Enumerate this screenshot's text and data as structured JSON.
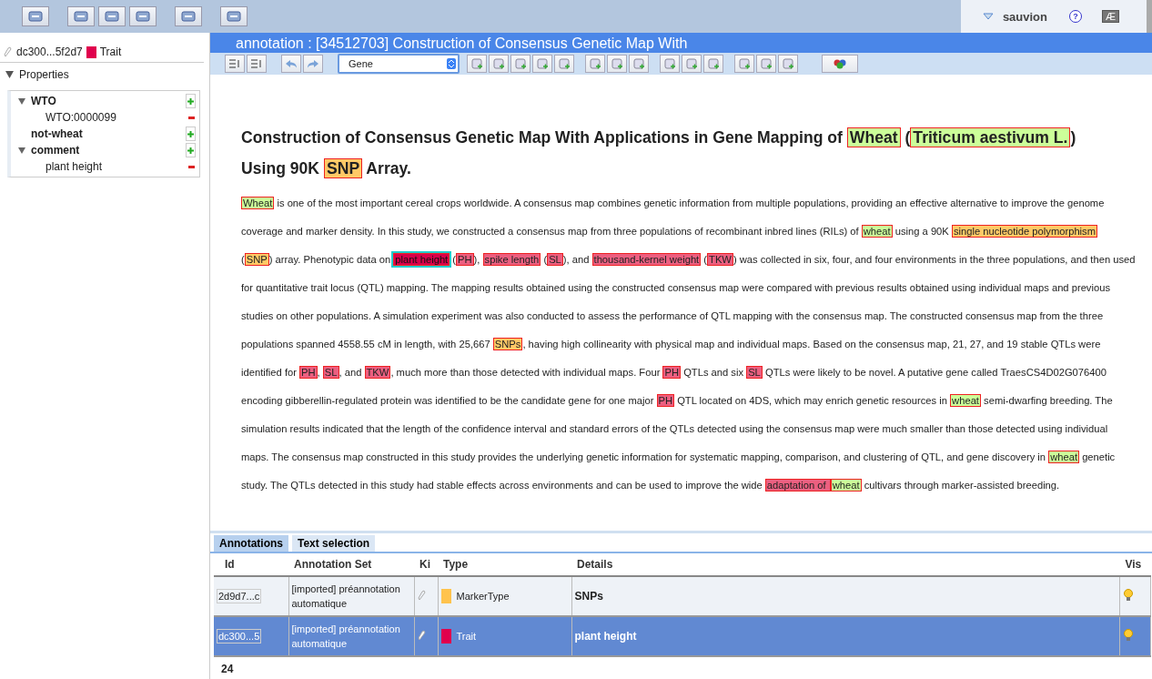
{
  "user": {
    "name": "sauvion",
    "help_label": "?",
    "keyboard_button": "Æ"
  },
  "left_panel": {
    "annotation_id": "dc300...5f2d7",
    "color": "#e0004d",
    "type_label": "Trait",
    "properties_label": "Properties",
    "properties_expanded": true,
    "properties": [
      {
        "label": "WTO",
        "expanded": true,
        "children": [
          {
            "label": "WTO:0000099"
          }
        ]
      },
      {
        "label": "not-wheat"
      },
      {
        "label": "comment",
        "expanded": true,
        "children": [
          {
            "label": "plant height"
          }
        ]
      }
    ]
  },
  "document": {
    "header_title": "annotation : [34512703] Construction of Consensus Genetic Map With",
    "type_select": "Gene",
    "title_lines": [
      [
        {
          "kind": "plain",
          "text": "Construction of Consensus Genetic Map With Applications in Gene Mapping of "
        },
        {
          "kind": "annotation",
          "text": "Wheat",
          "color": "#ccff99",
          "selected": false
        },
        {
          "kind": "plain",
          "text": " ("
        },
        {
          "kind": "annotation",
          "text": "Triticum aestivum L.",
          "color": "#ccff99",
          "selected": false
        },
        {
          "kind": "plain",
          "text": ")"
        }
      ],
      [
        {
          "kind": "plain",
          "text": "Using 90K "
        },
        {
          "kind": "annotation",
          "text": "SNP",
          "color": "#ffc966",
          "selected": false
        },
        {
          "kind": "plain",
          "text": " Array."
        }
      ]
    ],
    "abstract_lines": [
      [
        {
          "kind": "annotation",
          "text": "Wheat",
          "color": "#ccff99",
          "selected": false
        },
        {
          "kind": "plain",
          "text": " is one of the most important cereal crops worldwide. A consensus map combines genetic information from multiple populations, providing an effective alternative to improve the genome"
        }
      ],
      [
        {
          "kind": "plain",
          "text": "coverage and marker density. In this study, we constructed a consensus map from three populations of recombinant inbred lines (RILs) of "
        },
        {
          "kind": "annotation",
          "text": "wheat",
          "color": "#ccff99",
          "selected": false
        },
        {
          "kind": "plain",
          "text": " using a 90K "
        },
        {
          "kind": "annotation",
          "text": "single nucleotide polymorphism",
          "color": "#ffc966",
          "selected": false
        }
      ],
      [
        {
          "kind": "plain",
          "text": "("
        },
        {
          "kind": "annotation",
          "text": "SNP",
          "color": "#ffc966",
          "selected": false
        },
        {
          "kind": "plain",
          "text": ") array. Phenotypic data on "
        },
        {
          "kind": "annotation",
          "text": "plant height",
          "color": "#d8004a",
          "selected": true
        },
        {
          "kind": "plain",
          "text": " ("
        },
        {
          "kind": "annotation",
          "text": "PH",
          "color": "#ec5f80",
          "selected": false
        },
        {
          "kind": "plain",
          "text": "), "
        },
        {
          "kind": "annotation",
          "text": "spike length",
          "color": "#ec5f80",
          "selected": false
        },
        {
          "kind": "plain",
          "text": " ("
        },
        {
          "kind": "annotation",
          "text": "SL",
          "color": "#ec5f80",
          "selected": false
        },
        {
          "kind": "plain",
          "text": "), and "
        },
        {
          "kind": "annotation",
          "text": "thousand-kernel weight",
          "color": "#ec5f80",
          "selected": false
        },
        {
          "kind": "plain",
          "text": " ("
        },
        {
          "kind": "annotation",
          "text": "TKW",
          "color": "#ec5f80",
          "selected": false
        },
        {
          "kind": "plain",
          "text": ") was collected in six, four, and four environments in the three populations, and then used"
        }
      ],
      [
        {
          "kind": "plain",
          "text": "for quantitative trait locus (QTL) mapping. The mapping results obtained using the constructed consensus map were compared with previous results obtained using individual maps and previous"
        }
      ],
      [
        {
          "kind": "plain",
          "text": "studies on other populations. A simulation experiment was also conducted to assess the performance of QTL mapping with the consensus map. The constructed consensus map from the three"
        }
      ],
      [
        {
          "kind": "plain",
          "text": "populations spanned 4558.55 cM in length, with 25,667 "
        },
        {
          "kind": "annotation",
          "text": "SNPs",
          "color": "#ffc966",
          "selected": false
        },
        {
          "kind": "plain",
          "text": ", having high collinearity with physical map and individual maps. Based on the consensus map, 21, 27, and 19 stable QTLs were"
        }
      ],
      [
        {
          "kind": "plain",
          "text": "identified for "
        },
        {
          "kind": "annotation",
          "text": "PH",
          "color": "#ec5f80",
          "selected": false
        },
        {
          "kind": "plain",
          "text": ", "
        },
        {
          "kind": "annotation",
          "text": "SL",
          "color": "#ec5f80",
          "selected": false
        },
        {
          "kind": "plain",
          "text": ", and "
        },
        {
          "kind": "annotation",
          "text": "TKW",
          "color": "#ec5f80",
          "selected": false
        },
        {
          "kind": "plain",
          "text": ", much more than those detected with individual maps. Four "
        },
        {
          "kind": "annotation",
          "text": "PH",
          "color": "#ec5f80",
          "selected": false
        },
        {
          "kind": "plain",
          "text": " QTLs and six "
        },
        {
          "kind": "annotation",
          "text": "SL",
          "color": "#ec5f80",
          "selected": false
        },
        {
          "kind": "plain",
          "text": " QTLs were likely to be novel. A putative gene called TraesCS4D02G076400"
        }
      ],
      [
        {
          "kind": "plain",
          "text": "encoding gibberellin-regulated protein was identified to be the candidate gene for one major "
        },
        {
          "kind": "annotation",
          "text": "PH",
          "color": "#ec5f80",
          "selected": false
        },
        {
          "kind": "plain",
          "text": " QTL located on 4DS, which may enrich genetic resources in "
        },
        {
          "kind": "annotation",
          "text": "wheat",
          "color": "#ccff99",
          "selected": false
        },
        {
          "kind": "plain",
          "text": " semi-dwarfing breeding. The"
        }
      ],
      [
        {
          "kind": "plain",
          "text": "simulation results indicated that the length of the confidence interval and standard errors of the QTLs detected using the consensus map were much smaller than those detected using individual"
        }
      ],
      [
        {
          "kind": "plain",
          "text": "maps. The consensus map constructed in this study provides the underlying genetic information for systematic mapping, comparison, and clustering of QTL, and gene discovery in "
        },
        {
          "kind": "annotation",
          "text": "wheat",
          "color": "#ccff99",
          "selected": false
        },
        {
          "kind": "plain",
          "text": " genetic"
        }
      ],
      [
        {
          "kind": "plain",
          "text": "study. The QTLs detected in this study had stable effects across environments and can be used to improve the wide "
        },
        {
          "kind": "annotation",
          "text": "adaptation of ",
          "color": "#ec5f80",
          "selected": false
        },
        {
          "kind": "annotation",
          "text": "wheat",
          "color": "#ccff99",
          "selected": false
        },
        {
          "kind": "plain",
          "text": " cultivars through marker-assisted breeding."
        }
      ]
    ]
  },
  "bottom_tabs": [
    {
      "label": "Annotations",
      "selected": true
    },
    {
      "label": "Text selection",
      "selected": false
    }
  ],
  "table": {
    "columns": [
      "Id",
      "Annotation Set",
      "Ki",
      "Type",
      "Details",
      "Vis"
    ],
    "rows": [
      {
        "id": "2d9d7...c",
        "set": "[imported] préannotation automatique",
        "color": "#ffc34d",
        "type": "MarkerType",
        "details": "SNPs",
        "selected": false
      },
      {
        "id": "dc300...5",
        "set": "[imported] préannotation automatique",
        "color": "#e0004d",
        "type": "Trait",
        "details": "plant height",
        "selected": true
      }
    ],
    "count": "24"
  }
}
